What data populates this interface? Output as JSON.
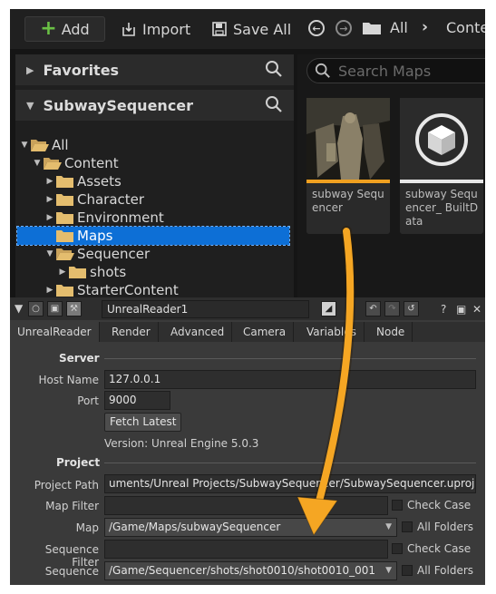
{
  "toolbar": {
    "add_label": "Add",
    "import_label": "Import",
    "saveall_label": "Save All",
    "path": [
      "All",
      "Content"
    ]
  },
  "left_panel": {
    "favorites": "Favorites",
    "project": "SubwaySequencer",
    "tree": [
      {
        "label": "All"
      },
      {
        "label": "Content"
      },
      {
        "label": "Assets"
      },
      {
        "label": "Character"
      },
      {
        "label": "Environment"
      },
      {
        "label": "Maps"
      },
      {
        "label": "Sequencer"
      },
      {
        "label": "shots"
      },
      {
        "label": "StarterContent"
      }
    ]
  },
  "right_panel": {
    "search_placeholder": "Search Maps",
    "assets": [
      {
        "label": "subway Sequencer",
        "bar_color": "#f0a020"
      },
      {
        "label": "subway Sequencer_ BuiltData",
        "bar_color": "#e6e6e6"
      }
    ]
  },
  "props": {
    "node_name": "UnrealReader1",
    "tabs": [
      "UnrealReader",
      "Render",
      "Advanced",
      "Camera",
      "Variables",
      "Node"
    ],
    "server": {
      "title": "Server",
      "host_label": "Host Name",
      "host_value": "127.0.0.1",
      "port_label": "Port",
      "port_value": "9000",
      "fetch_label": "Fetch Latest",
      "version_text": "Version: Unreal Engine 5.0.3"
    },
    "project": {
      "title": "Project",
      "path_label": "Project Path",
      "path_value": "uments/Unreal Projects/SubwaySequencer/SubwaySequencer.uproject",
      "mapfilter_label": "Map Filter",
      "mapfilter_value": "",
      "checkcase_label": "Check Case",
      "map_label": "Map",
      "map_value": "/Game/Maps/subwaySequencer",
      "allfolders_label": "All Folders",
      "seqfilter_label": "Sequence Filter",
      "seqfilter_value": "",
      "sequence_label": "Sequence",
      "sequence_value": "/Game/Sequencer/shots/shot0010/shot0010_001"
    }
  },
  "colors": {
    "accent_selection": "#0d6fd6",
    "arrow": "#f5a623",
    "add_plus": "#6ac045"
  }
}
